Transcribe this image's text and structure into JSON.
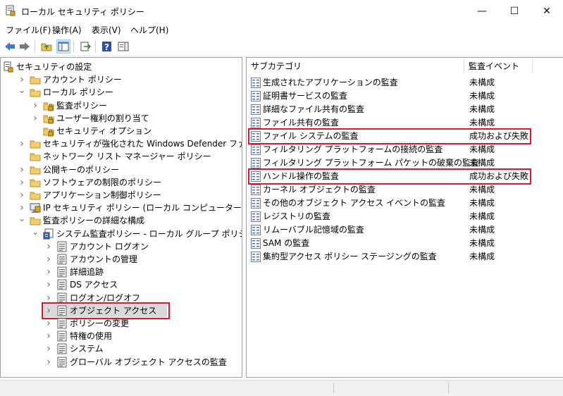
{
  "window": {
    "title": "ローカル セキュリティ ポリシー",
    "minimize": "—",
    "maximize": "☐",
    "close": "✕"
  },
  "menu": [
    {
      "label": "ファイル(F)"
    },
    {
      "label": "操作(A)"
    },
    {
      "label": "表示(V)"
    },
    {
      "label": "ヘルプ(H)"
    }
  ],
  "tree": {
    "root": "セキュリティの設定",
    "items": [
      {
        "label": "アカウント ポリシー"
      },
      {
        "label": "ローカル ポリシー"
      },
      {
        "label": "監査ポリシー"
      },
      {
        "label": "ユーザー権利の割り当て"
      },
      {
        "label": "セキュリティ オプション"
      },
      {
        "label": "セキュリティが強化された Windows Defender ファイアウォール"
      },
      {
        "label": "ネットワーク リスト マネージャー ポリシー"
      },
      {
        "label": "公開キーのポリシー"
      },
      {
        "label": "ソフトウェアの制限のポリシー"
      },
      {
        "label": "アプリケーション制御ポリシー"
      },
      {
        "label": "IP セキュリティ ポリシー (ローカル コンピューター)"
      },
      {
        "label": "監査ポリシーの詳細な構成"
      },
      {
        "label": "システム監査ポリシー - ローカル グループ ポリシー オブジェクト"
      },
      {
        "label": "アカウント ログオン"
      },
      {
        "label": "アカウントの管理"
      },
      {
        "label": "詳細追跡"
      },
      {
        "label": "DS アクセス"
      },
      {
        "label": "ログオン/ログオフ"
      },
      {
        "label": "オブジェクト アクセス"
      },
      {
        "label": "ポリシーの変更"
      },
      {
        "label": "特権の使用"
      },
      {
        "label": "システム"
      },
      {
        "label": "グローバル オブジェクト アクセスの監査"
      }
    ]
  },
  "list": {
    "headers": {
      "subcategory": "サブカテゴリ",
      "audit_event": "監査イベント"
    },
    "rows": [
      {
        "name": "生成されたアプリケーションの監査",
        "status": "未構成"
      },
      {
        "name": "証明書サービスの監査",
        "status": "未構成"
      },
      {
        "name": "詳細なファイル共有の監査",
        "status": "未構成"
      },
      {
        "name": "ファイル共有の監査",
        "status": "未構成"
      },
      {
        "name": "ファイル システムの監査",
        "status": "成功および失敗"
      },
      {
        "name": "フィルタリング プラットフォームの接続の監査",
        "status": "未構成"
      },
      {
        "name": "フィルタリング プラットフォーム パケットの破棄の監査",
        "status": "未構成"
      },
      {
        "name": "ハンドル操作の監査",
        "status": "成功および失敗"
      },
      {
        "name": "カーネル オブジェクトの監査",
        "status": "未構成"
      },
      {
        "name": "その他のオブジェクト アクセス イベントの監査",
        "status": "未構成"
      },
      {
        "name": "レジストリの監査",
        "status": "未構成"
      },
      {
        "name": "リムーバブル記憶域の監査",
        "status": "未構成"
      },
      {
        "name": "SAM の監査",
        "status": "未構成"
      },
      {
        "name": "集約型アクセス ポリシー ステージングの監査",
        "status": "未構成"
      }
    ]
  },
  "colors": {
    "highlight": "#e0162b",
    "selection": "#cce8ff"
  }
}
